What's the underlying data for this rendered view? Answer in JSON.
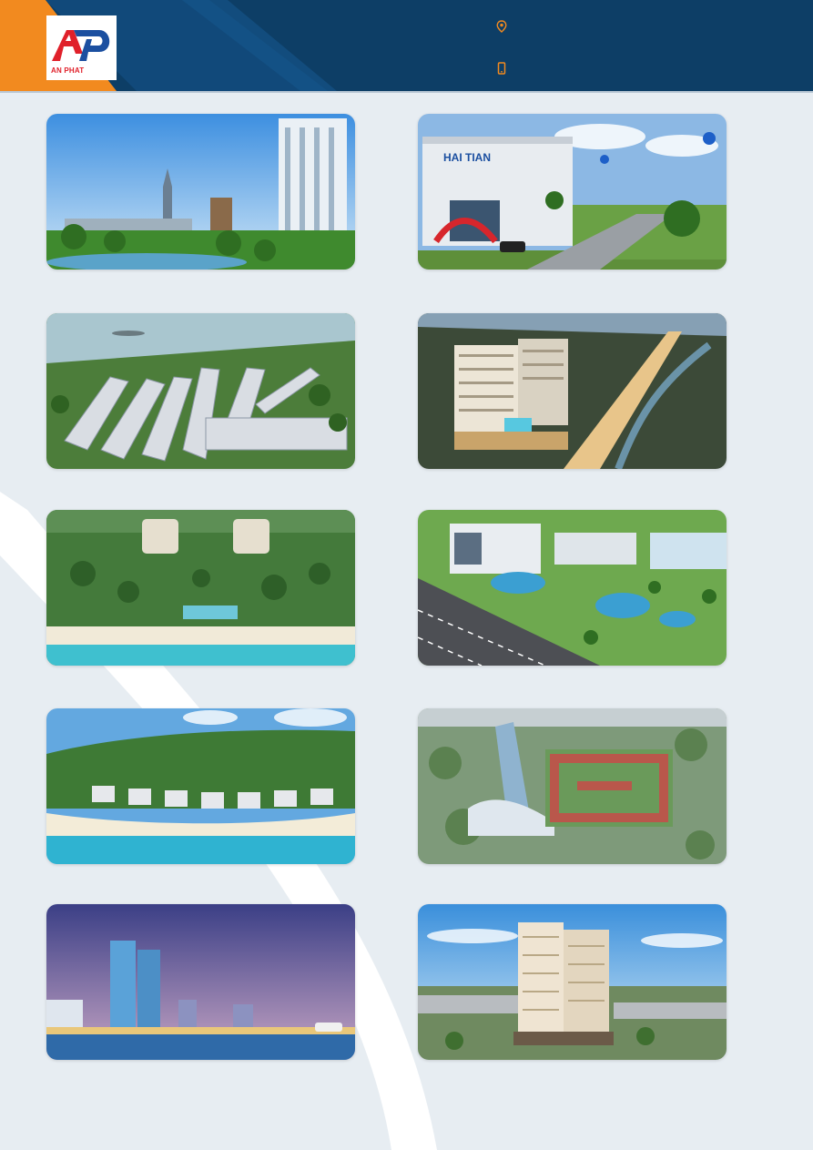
{
  "brand": {
    "logo_letters": "AP",
    "logo_caption": "AN PHAT",
    "colors": {
      "navy": "#0d3e66",
      "orange": "#f28a1f",
      "red": "#e0202a",
      "blue": "#1b4fa0"
    }
  },
  "header": {
    "contacts": [
      {
        "icon": "map-pin-icon",
        "text": ""
      },
      {
        "icon": "mobile-phone-icon",
        "text": ""
      }
    ]
  },
  "gallery": {
    "photos": [
      {
        "subject": "riverside high-rise tower with city skyline"
      },
      {
        "subject": "factory building with opening ceremony arch and balloons",
        "signage": "HAI TIAN"
      },
      {
        "subject": "aerial view of townhouse villa rows along a river"
      },
      {
        "subject": "apartment tower among town at dusk"
      },
      {
        "subject": "beach resort with two curved hotel towers"
      },
      {
        "subject": "industrial complex with ponds and roadway"
      },
      {
        "subject": "beachfront villas beneath forested hills"
      },
      {
        "subject": "glass tower with red-roofed townhouse blocks"
      },
      {
        "subject": "twin towers on seafront at twilight with cruise ship"
      },
      {
        "subject": "residential tower overlooking suburbs"
      }
    ]
  }
}
